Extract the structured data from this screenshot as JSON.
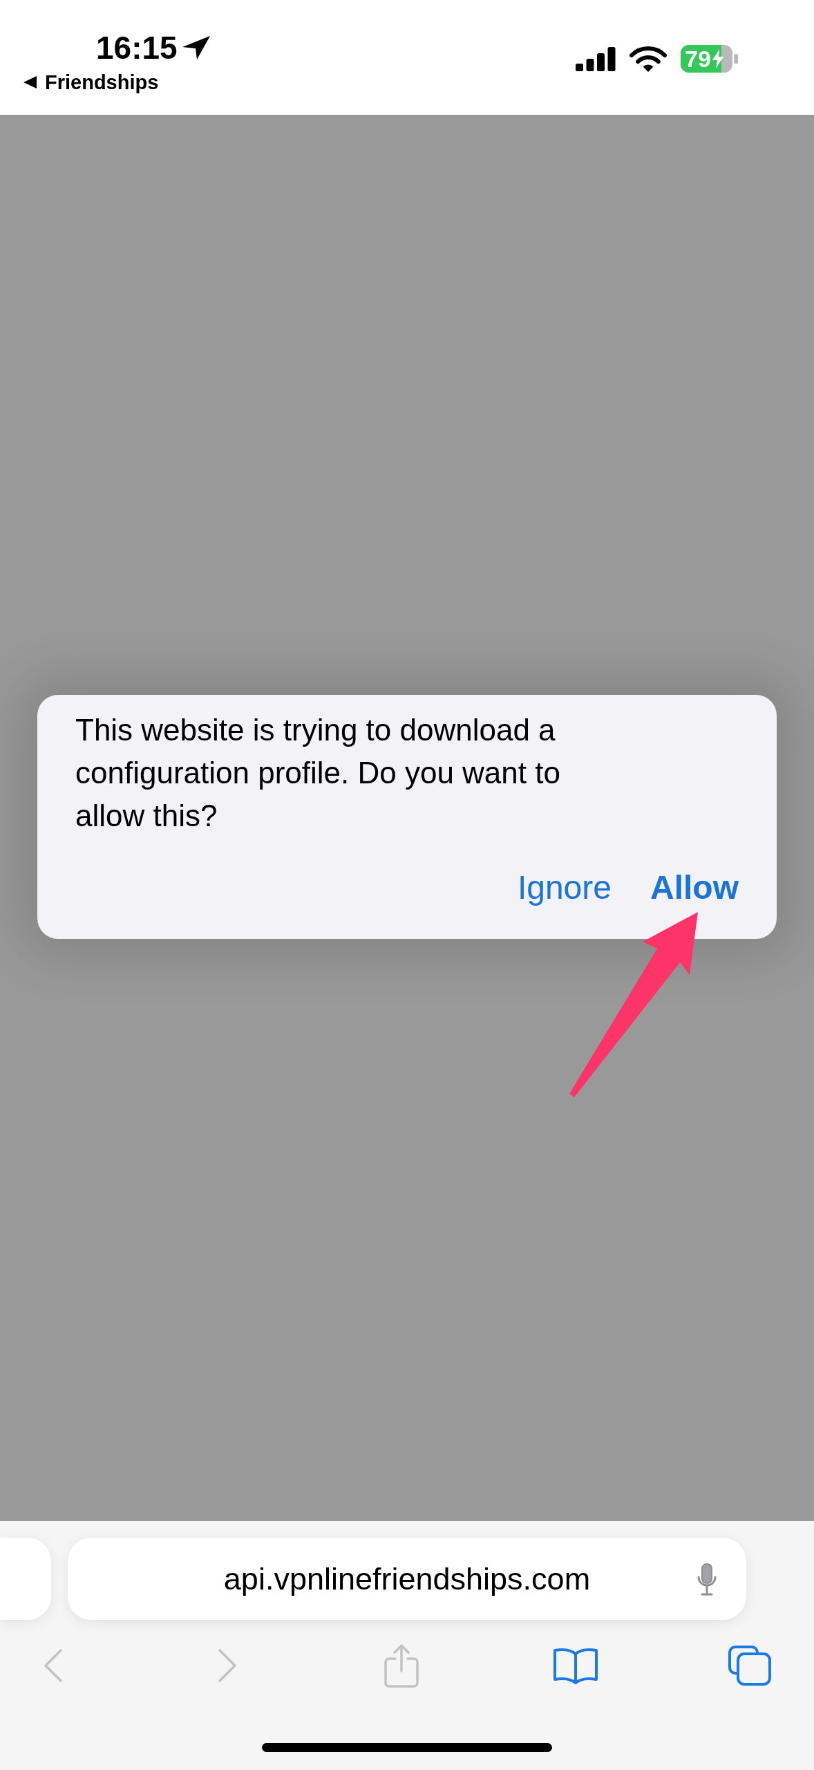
{
  "status_bar": {
    "time": "16:15",
    "back_link": "Friendships",
    "battery_percent": "79"
  },
  "dialog": {
    "message": "This website is trying to download a configuration profile. Do you want to allow this?",
    "buttons": [
      {
        "label": "Ignore",
        "kind": "ignore"
      },
      {
        "label": "Allow",
        "kind": "allow"
      }
    ]
  },
  "address_bar": {
    "url": "api.vpnlinefriendships.com"
  },
  "toolbar": {
    "buttons": [
      {
        "kind": "back",
        "disabled": true
      },
      {
        "kind": "forward",
        "disabled": true
      },
      {
        "kind": "share",
        "disabled": true
      },
      {
        "kind": "bookmarks",
        "disabled": false
      },
      {
        "kind": "tabs",
        "disabled": false
      }
    ]
  }
}
